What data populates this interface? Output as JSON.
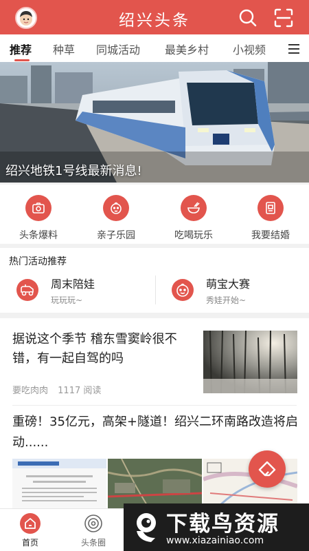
{
  "header": {
    "title": "绍兴头条",
    "brand_color": "#e2554d",
    "icons": [
      "avatar",
      "search-icon",
      "scan-icon"
    ]
  },
  "tabs": [
    {
      "label": "推荐",
      "active": true
    },
    {
      "label": "种草",
      "active": false
    },
    {
      "label": "同城活动",
      "active": false
    },
    {
      "label": "最美乡村",
      "active": false
    },
    {
      "label": "小视频",
      "active": false
    }
  ],
  "banner": {
    "caption": "绍兴地铁1号线最新消息!"
  },
  "quick_actions": [
    {
      "label": "头条爆料",
      "icon": "camera-icon"
    },
    {
      "label": "亲子乐园",
      "icon": "baby-face-icon"
    },
    {
      "label": "吃喝玩乐",
      "icon": "bowl-icon"
    },
    {
      "label": "我要结婚",
      "icon": "certificate-icon"
    }
  ],
  "hot_activities": {
    "title": "热门活动推荐",
    "items": [
      {
        "name": "周末陪娃",
        "subtitle": "玩玩玩~",
        "icon": "toy-car-icon"
      },
      {
        "name": "萌宝大赛",
        "subtitle": "秀娃开始~",
        "icon": "baby-face-icon"
      }
    ]
  },
  "articles": [
    {
      "title": "据说这个季节 稽东雪窦岭很不错，有一起自驾的吗",
      "author": "要吃肉肉",
      "reads": "1117 阅读"
    },
    {
      "title": "重磅！35亿元，高架+隧道！绍兴二环南路改造将启动......"
    }
  ],
  "bottom_nav": [
    {
      "label": "首页",
      "active": true,
      "icon": "home-icon"
    },
    {
      "label": "头条圈",
      "active": false,
      "icon": "circle-feed-icon"
    }
  ],
  "watermark": {
    "main": "下载鸟资源",
    "url": "www.xiazainiao.com"
  }
}
